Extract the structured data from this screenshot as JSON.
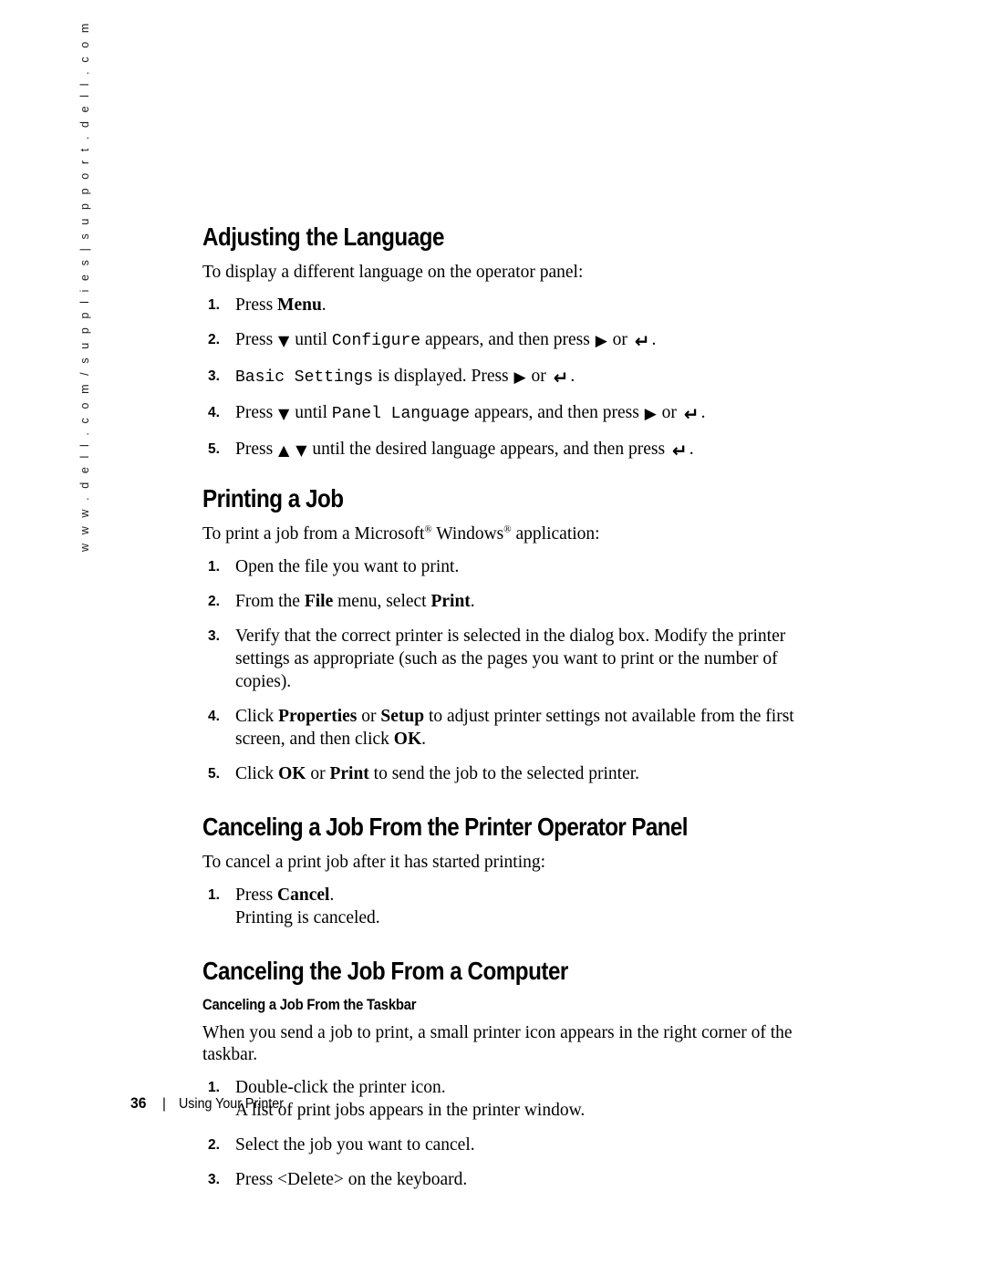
{
  "page": {
    "number": "36",
    "chapter": "Using Your Printer",
    "separator": "|",
    "side_url": "w w w . d e l l . c o m / s u p p l i e s  |  s u p p o r t . d e l l . c o m"
  },
  "glyphs": {
    "down_arrow": "▼",
    "up_arrow": "▲",
    "right_arrow": "▶",
    "enter_key": "↵"
  },
  "sections": {
    "adjusting_language": {
      "title": "Adjusting the Language",
      "intro": "To display a different language on the operator panel:",
      "steps": {
        "s1_a": "Press ",
        "s1_b": "Menu",
        "s1_c": ".",
        "s2_a": "Press ",
        "s2_b": " until ",
        "s2_mono": "Configure",
        "s2_c": " appears, and then press ",
        "s2_or": " or ",
        "s2_end": ".",
        "s3_mono": "Basic Settings",
        "s3_a": " is displayed. Press ",
        "s3_or": " or ",
        "s3_end": ".",
        "s4_a": "Press ",
        "s4_b": " until ",
        "s4_mono": "Panel Language",
        "s4_c": " appears, and then press ",
        "s4_or": " or ",
        "s4_end": ".",
        "s5_a": "Press ",
        "s5_b": " until the desired language appears, and then press ",
        "s5_end": "."
      }
    },
    "printing_job": {
      "title": "Printing a Job",
      "intro_a": "To print a job from a Microsoft",
      "intro_reg1": "®",
      "intro_b": " Windows",
      "intro_reg2": "®",
      "intro_c": " application:",
      "steps": {
        "s1": "Open the file you want to print.",
        "s2_a": "From the ",
        "s2_file": "File",
        "s2_b": " menu, select ",
        "s2_print": "Print",
        "s2_c": ".",
        "s3": "Verify that the correct printer is selected in the dialog box. Modify the printer settings as appropriate (such as the pages you want to print or the number of copies).",
        "s4_a": "Click ",
        "s4_props": "Properties",
        "s4_b": " or ",
        "s4_setup": "Setup",
        "s4_c": " to adjust printer settings not available from the first screen, and then click ",
        "s4_ok": "OK",
        "s4_d": ".",
        "s5_a": "Click ",
        "s5_ok": "OK",
        "s5_b": " or ",
        "s5_print": "Print",
        "s5_c": " to send the job to the selected printer."
      }
    },
    "cancel_operator_panel": {
      "title": "Canceling a Job From the Printer Operator Panel",
      "intro": "To cancel a print job after it has started printing:",
      "steps": {
        "s1_a": "Press ",
        "s1_cancel": "Cancel",
        "s1_b": ".",
        "s1_result": "Printing is canceled."
      }
    },
    "cancel_computer": {
      "title": "Canceling the Job From a Computer",
      "subtitle": "Canceling a Job From the Taskbar",
      "intro": "When you send a job to print, a small printer icon appears in the right corner of the taskbar.",
      "steps": {
        "s1": "Double-click the printer icon.",
        "s1_result": "A list of print jobs appears in the printer window.",
        "s2": "Select the job you want to cancel.",
        "s3": "Press <Delete> on the keyboard."
      }
    }
  }
}
